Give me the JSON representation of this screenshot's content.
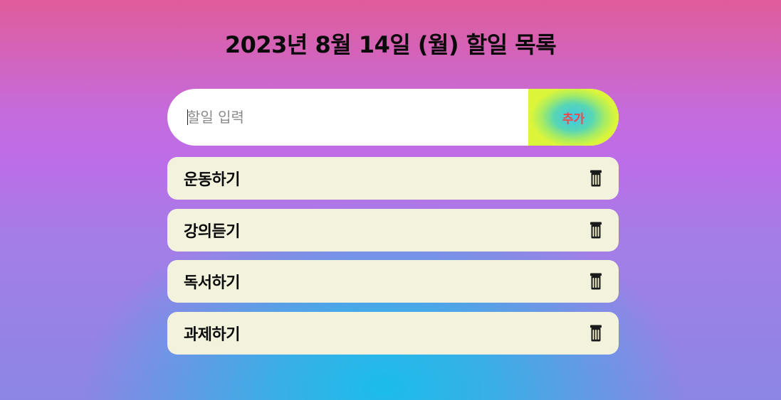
{
  "header": {
    "title": "2023년 8월 14일 (월) 할일 목록"
  },
  "input": {
    "placeholder": "할일 입력",
    "value": ""
  },
  "add_button": {
    "label": "추가"
  },
  "todos": [
    {
      "text": "운동하기",
      "delete_icon": "trash-icon"
    },
    {
      "text": "강의듣기",
      "delete_icon": "trash-icon"
    },
    {
      "text": "독서하기",
      "delete_icon": "trash-icon"
    },
    {
      "text": "과제하기",
      "delete_icon": "trash-icon"
    }
  ],
  "colors": {
    "item_background": "#f3f2dc",
    "add_button_text": "#f04848",
    "gradient_top": "#e05c9a",
    "gradient_mid": "#bd6de8",
    "gradient_glow": "#1bbde8"
  }
}
